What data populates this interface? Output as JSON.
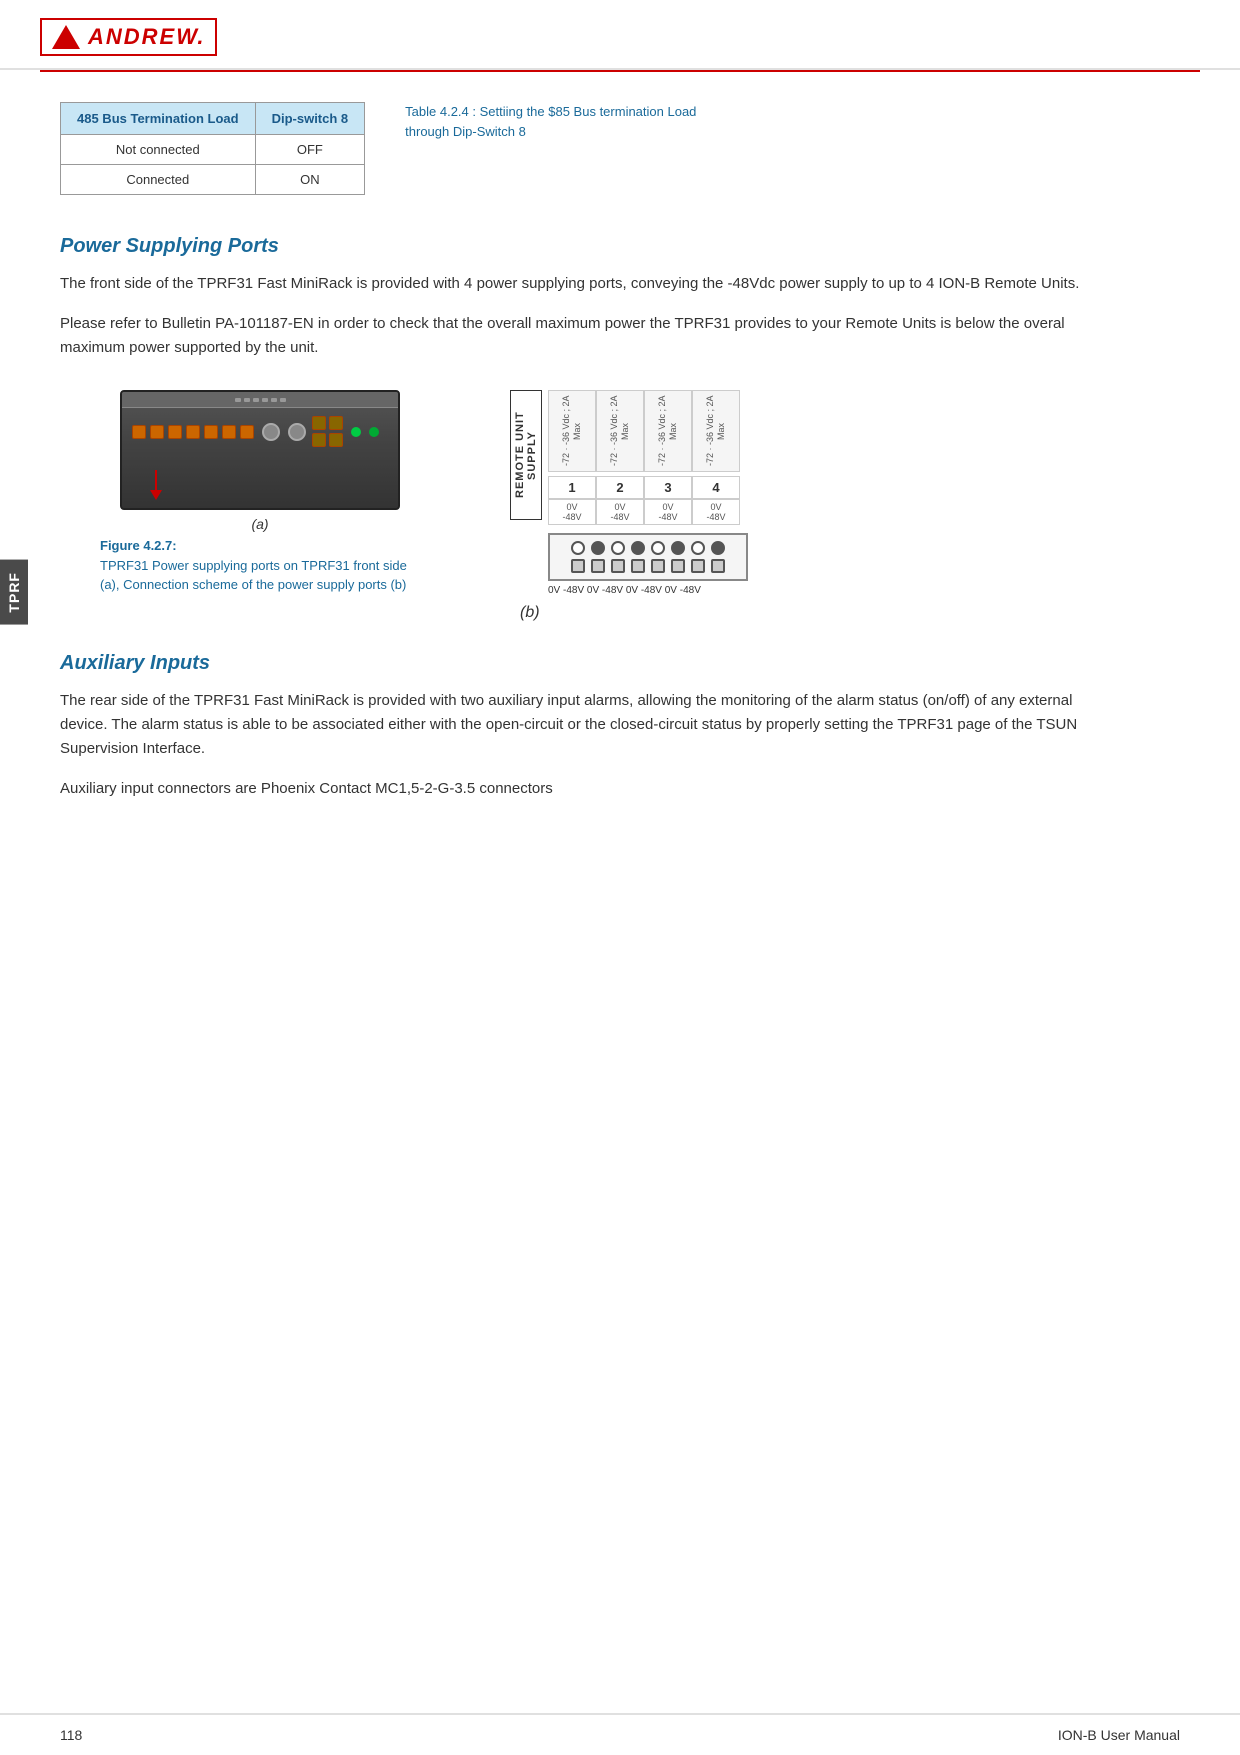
{
  "header": {
    "logo_text": "ANDREW.",
    "logo_tagline": ""
  },
  "sidebar": {
    "label": "TPRF"
  },
  "table": {
    "col1_header": "485 Bus Termination Load",
    "col2_header": "Dip-switch 8",
    "rows": [
      {
        "col1": "Not connected",
        "col2": "OFF"
      },
      {
        "col1": "Connected",
        "col2": "ON"
      }
    ],
    "caption": "Table 4.2.4 : Settiing the $85 Bus termination Load through Dip-Switch 8"
  },
  "power_section": {
    "heading": "Power Supplying Ports",
    "para1": "The front side of the TPRF31 Fast MiniRack is provided with 4 power supplying ports, conveying the -48Vdc power supply to up to 4 ION-B Remote Units.",
    "para2": "Please refer to Bulletin PA-101187-EN in order to check that the overall maximum power the TPRF31 provides to your Remote Units is below the overal maximum power supported by the unit.",
    "figure": {
      "label_a": "(a)",
      "label_b": "(b)",
      "caption_title": "Figure 4.2.7:",
      "caption_text": "TPRF31 Power supplying ports on TPRF31 front side (a), Connection scheme of the power supply ports (b)",
      "remote_unit_label": "REMOTE UNIT SUPPLY",
      "channels": [
        {
          "number": "1",
          "range": "-72 · -36 Vdc ; 2A Max",
          "v_top": "0V",
          "v_bot": "-48V"
        },
        {
          "number": "2",
          "range": "-72 · -36 Vdc ; 2A Max",
          "v_top": "0V",
          "v_bot": "-48V"
        },
        {
          "number": "3",
          "range": "-72 · -36 Vdc ; 2A Max",
          "v_top": "0V",
          "v_bot": "-48V"
        },
        {
          "number": "4",
          "range": "-72 · -36 Vdc ; 2A Max",
          "v_top": "0V",
          "v_bot": "-48V"
        }
      ],
      "voltage_row": "0V  -48V  0V  -48V  0V  -48V  0V  -48V"
    }
  },
  "auxiliary_section": {
    "heading": "Auxiliary Inputs",
    "para1": "The rear side of the TPRF31 Fast MiniRack is provided with two auxiliary input alarms, allowing the monitoring of the alarm status (on/off) of any external device. The alarm status is able to be associated either with the open-circuit or the closed-circuit status by properly setting the TPRF31 page of the TSUN Supervision Interface.",
    "para2": "Auxiliary input connectors are Phoenix Contact MC1,5-2-G-3.5 connectors"
  },
  "footer": {
    "page_number": "118",
    "document_title": "ION-B User Manual"
  }
}
